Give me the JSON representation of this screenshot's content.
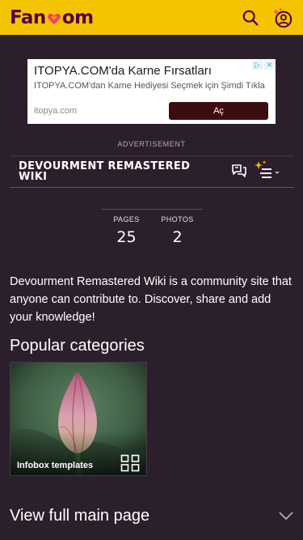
{
  "colors": {
    "header_bg": "#f5c400",
    "page_bg": "#2c1f2c",
    "logo": "#520044",
    "heart": "#ff3c65",
    "ad_button": "#3d0c11"
  },
  "header": {
    "logo_prefix": "Fan",
    "logo_suffix": "om",
    "search_icon": "search-icon",
    "user_icon": "user-icon"
  },
  "ad": {
    "title": "ITOPYA.COM'da Karne Fırsatları",
    "description": "ITOPYA.COM'dan Karne Hediyesi Seçmek için Şimdi Tıkla",
    "domain": "itopya.com",
    "button_label": "Aç",
    "label": "ADVERTISEMENT"
  },
  "wiki": {
    "title": "DEVOURMENT REMASTERED WIKI"
  },
  "stats": [
    {
      "label": "PAGES",
      "value": "25"
    },
    {
      "label": "PHOTOS",
      "value": "2"
    }
  ],
  "description": "Devourment Remastered Wiki is a community site that anyone can contribute to. Discover, share and add your knowledge!",
  "popular": {
    "title": "Popular categories",
    "card_label": "Infobox templates"
  },
  "view_full": {
    "label": "View full main page"
  }
}
